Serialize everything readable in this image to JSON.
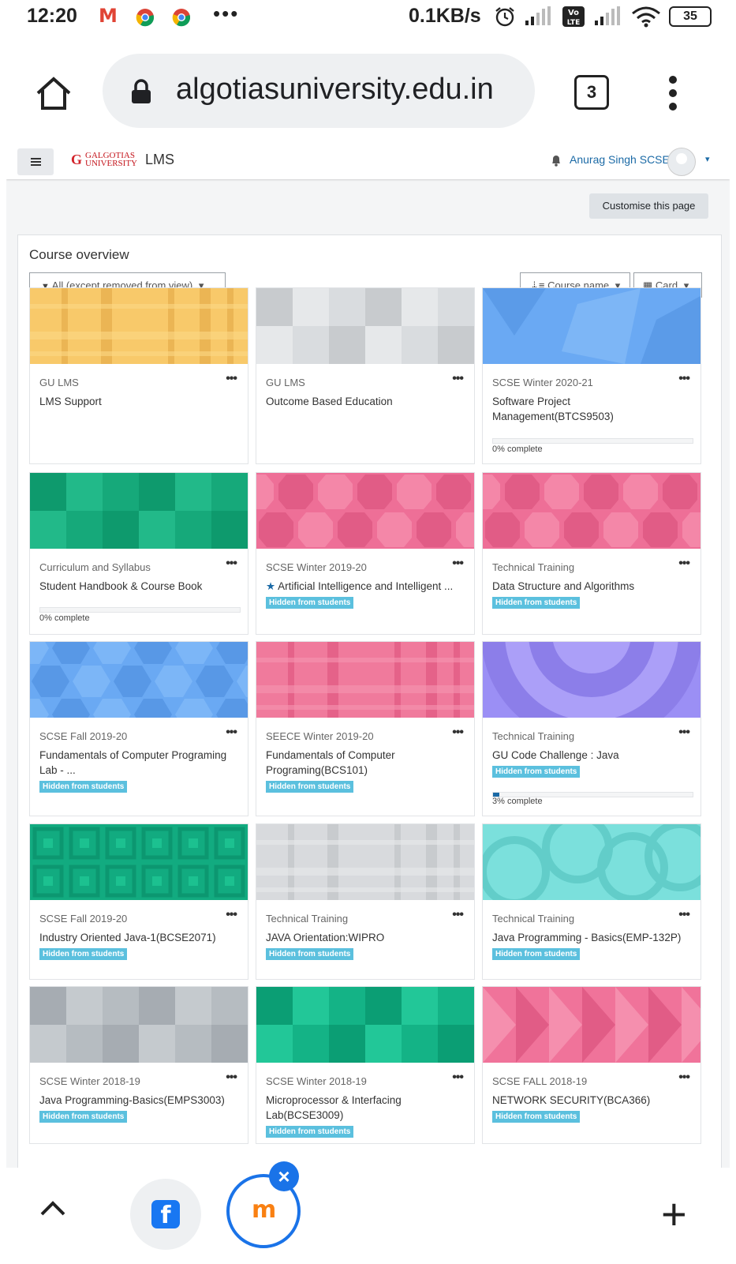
{
  "status_bar": {
    "time": "12:20",
    "gmail_glyph": "M",
    "more_indicator": "•••",
    "net_speed": "0.1KB/s",
    "battery": "35"
  },
  "browser": {
    "url": "algotiasuniversity.edu.in",
    "tab_count": "3"
  },
  "navbar": {
    "logo_letter": "G",
    "logo_line1": "GALGOTIAS",
    "logo_line2": "UNIVERSITY",
    "site_name": "LMS",
    "user_name": "Anurag Singh SCSE",
    "user_caret": "▾"
  },
  "customise_button": "Customise this page",
  "block": {
    "title": "Course overview",
    "filter_label": "All (except removed from view)",
    "sort_label": "Course name",
    "view_label": "Card",
    "dropdown_caret": "▾"
  },
  "more_glyph": "•••",
  "star_glyph": "★",
  "courses": [
    {
      "category": "GU LMS",
      "name": "LMS Support",
      "hidden_label": "",
      "progress_label": ""
    },
    {
      "category": "GU LMS",
      "name": "Outcome Based Education",
      "hidden_label": "",
      "progress_label": ""
    },
    {
      "category": "SCSE Winter 2020-21",
      "name": "Software Project Management(BTCS9503)",
      "hidden_label": "",
      "progress_label": "0% complete",
      "progress": 0
    },
    {
      "category": "Curriculum and Syllabus",
      "name": "Student Handbook & Course Book",
      "hidden_label": "",
      "progress_label": "0% complete",
      "progress": 0
    },
    {
      "category": "SCSE Winter 2019-20",
      "name": "Artificial Intelligence and Intelligent ...",
      "starred": true,
      "hidden_label": "Hidden from students",
      "progress_label": ""
    },
    {
      "category": "Technical Training",
      "name": "Data Structure and Algorithms",
      "hidden_label": "Hidden from students",
      "progress_label": ""
    },
    {
      "category": "SCSE Fall 2019-20",
      "name": "Fundamentals of Computer Programing Lab - ...",
      "hidden_label": "Hidden from students",
      "progress_label": ""
    },
    {
      "category": "SEECE Winter 2019-20",
      "name": "Fundamentals of Computer Programing(BCS101)",
      "hidden_label": "Hidden from students",
      "progress_label": ""
    },
    {
      "category": "Technical Training",
      "name": "GU Code Challenge : Java",
      "hidden_label": "Hidden from students",
      "progress_label": "3% complete",
      "progress": 3
    },
    {
      "category": "SCSE Fall 2019-20",
      "name": "Industry Oriented Java-1(BCSE2071)",
      "hidden_label": "Hidden from students",
      "progress_label": ""
    },
    {
      "category": "Technical Training",
      "name": "JAVA Orientation:WIPRO",
      "hidden_label": "Hidden from students",
      "progress_label": ""
    },
    {
      "category": "Technical Training",
      "name": "Java Programming - Basics(EMP-132P)",
      "hidden_label": "Hidden from students",
      "progress_label": ""
    },
    {
      "category": "SCSE Winter 2018-19",
      "name": "Java Programming-Basics(EMPS3003)",
      "hidden_label": "Hidden from students",
      "progress_label": ""
    },
    {
      "category": "SCSE Winter 2018-19",
      "name": "Microprocessor & Interfacing Lab(BCSE3009)",
      "hidden_label": "Hidden from students",
      "progress_label": ""
    },
    {
      "category": "SCSE FALL 2018-19",
      "name": "NETWORK SECURITY(BCA366)",
      "hidden_label": "Hidden from students",
      "progress_label": ""
    }
  ],
  "bottom_bar": {
    "fb_glyph": "f",
    "moodle_glyph": "m",
    "close_glyph": "×",
    "plus_glyph": "+"
  },
  "colors": {
    "link_blue": "#1b6aa6",
    "hidden_badge": "#5bc0de",
    "chrome_blue": "#1a73e8"
  },
  "icons": [
    "home-icon",
    "lock-icon",
    "tabs-icon",
    "overflow-menu-icon",
    "hamburger-icon",
    "bell-icon",
    "avatar-icon",
    "filter-icon",
    "sort-icon",
    "grid-icon",
    "star-icon",
    "chevron-up-icon",
    "facebook-icon",
    "moodle-icon",
    "close-icon",
    "plus-icon"
  ]
}
